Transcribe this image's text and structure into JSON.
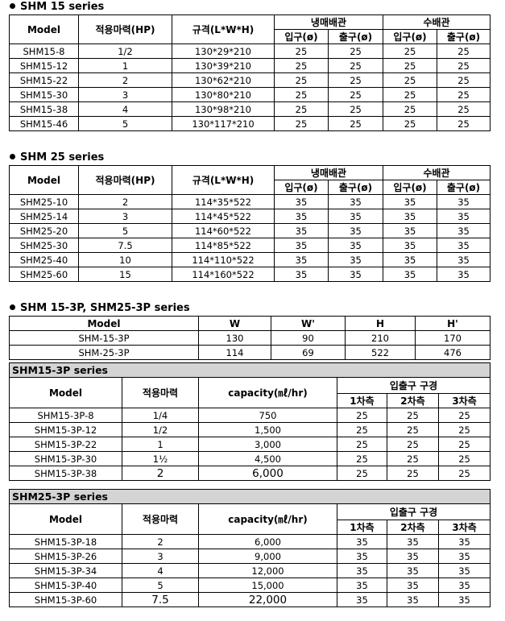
{
  "s15": {
    "title": "SHM 15 series",
    "headers": {
      "model": "Model",
      "hp": "적용마력(HP)",
      "size": "규격(L*W*H)",
      "ref": "냉매배관",
      "water": "수배관",
      "in": "입구(ø)",
      "out": "출구(ø)"
    },
    "rows": [
      [
        "SHM15-8",
        "1/2",
        "130*29*210",
        "25",
        "25",
        "25",
        "25"
      ],
      [
        "SHM15-12",
        "1",
        "130*39*210",
        "25",
        "25",
        "25",
        "25"
      ],
      [
        "SHM15-22",
        "2",
        "130*62*210",
        "25",
        "25",
        "25",
        "25"
      ],
      [
        "SHM15-30",
        "3",
        "130*80*210",
        "25",
        "25",
        "25",
        "25"
      ],
      [
        "SHM15-38",
        "4",
        "130*98*210",
        "25",
        "25",
        "25",
        "25"
      ],
      [
        "SHM15-46",
        "5",
        "130*117*210",
        "25",
        "25",
        "25",
        "25"
      ]
    ]
  },
  "s25": {
    "title": "SHM 25 series",
    "headers": {
      "model": "Model",
      "hp": "적용마력(HP)",
      "size": "규격(L*W*H)",
      "ref": "냉매배관",
      "water": "수배관",
      "in": "입구(ø)",
      "out": "출구(ø)"
    },
    "rows": [
      [
        "SHM25-10",
        "2",
        "114*35*522",
        "35",
        "35",
        "35",
        "35"
      ],
      [
        "SHM25-14",
        "3",
        "114*45*522",
        "35",
        "35",
        "35",
        "35"
      ],
      [
        "SHM25-20",
        "5",
        "114*60*522",
        "35",
        "35",
        "35",
        "35"
      ],
      [
        "SHM25-30",
        "7.5",
        "114*85*522",
        "35",
        "35",
        "35",
        "35"
      ],
      [
        "SHM25-40",
        "10",
        "114*110*522",
        "35",
        "35",
        "35",
        "35"
      ],
      [
        "SHM25-60",
        "15",
        "114*160*522",
        "35",
        "35",
        "35",
        "35"
      ]
    ]
  },
  "s3p": {
    "title": "SHM 15-3P, SHM25-3P series",
    "dims": {
      "headers": [
        "Model",
        "W",
        "W'",
        "H",
        "H'"
      ],
      "rows": [
        [
          "SHM-15-3P",
          "130",
          "90",
          "210",
          "170"
        ],
        [
          "SHM-25-3P",
          "114",
          "69",
          "522",
          "476"
        ]
      ]
    },
    "headers": {
      "model": "Model",
      "hp": "적용마력",
      "cap": "capacity(㎖/hr)",
      "port": "입출구 구경",
      "p1": "1차측",
      "p2": "2차측",
      "p3": "3차측"
    },
    "t15": {
      "band": "SHM15-3P series",
      "rows": [
        [
          "SHM15-3P-8",
          "1/4",
          "750",
          "25",
          "25",
          "25"
        ],
        [
          "SHM15-3P-12",
          "1/2",
          "1,500",
          "25",
          "25",
          "25"
        ],
        [
          "SHM15-3P-22",
          "1",
          "3,000",
          "25",
          "25",
          "25"
        ],
        [
          "SHM15-3P-30",
          "1½",
          "4,500",
          "25",
          "25",
          "25"
        ],
        [
          "SHM15-3P-38",
          "2",
          "6,000",
          "25",
          "25",
          "25"
        ]
      ]
    },
    "t25": {
      "band": "SHM25-3P series",
      "rows": [
        [
          "SHM15-3P-18",
          "2",
          "6,000",
          "35",
          "35",
          "35"
        ],
        [
          "SHM15-3P-26",
          "3",
          "9,000",
          "35",
          "35",
          "35"
        ],
        [
          "SHM15-3P-34",
          "4",
          "12,000",
          "35",
          "35",
          "35"
        ],
        [
          "SHM15-3P-40",
          "5",
          "15,000",
          "35",
          "35",
          "35"
        ],
        [
          "SHM15-3P-60",
          "7.5",
          "22,000",
          "35",
          "35",
          "35"
        ]
      ]
    }
  }
}
